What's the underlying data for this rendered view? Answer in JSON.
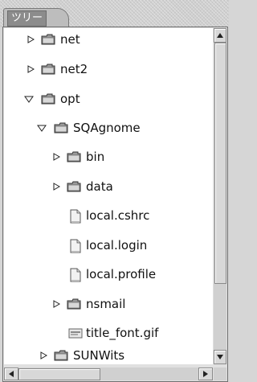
{
  "tab": {
    "label": "ツリー"
  },
  "tree": {
    "items": [
      {
        "label": "net",
        "type": "folder",
        "state": "collapsed"
      },
      {
        "label": "net2",
        "type": "folder",
        "state": "collapsed"
      },
      {
        "label": "opt",
        "type": "folder",
        "state": "expanded"
      },
      {
        "label": "SQAgnome",
        "type": "folder",
        "state": "expanded"
      },
      {
        "label": "bin",
        "type": "folder",
        "state": "collapsed"
      },
      {
        "label": "data",
        "type": "folder",
        "state": "collapsed"
      },
      {
        "label": "local.cshrc",
        "type": "file"
      },
      {
        "label": "local.login",
        "type": "file"
      },
      {
        "label": "local.profile",
        "type": "file"
      },
      {
        "label": "nsmail",
        "type": "folder",
        "state": "collapsed"
      },
      {
        "label": "title_font.gif",
        "type": "image-file"
      },
      {
        "label": "SUNWits",
        "type": "folder",
        "state": "collapsed"
      }
    ]
  },
  "icons": {
    "folder": "folder-icon",
    "file": "document-icon",
    "image-file": "image-file-icon",
    "collapsed": "triangle-right-icon",
    "expanded": "triangle-down-icon"
  }
}
